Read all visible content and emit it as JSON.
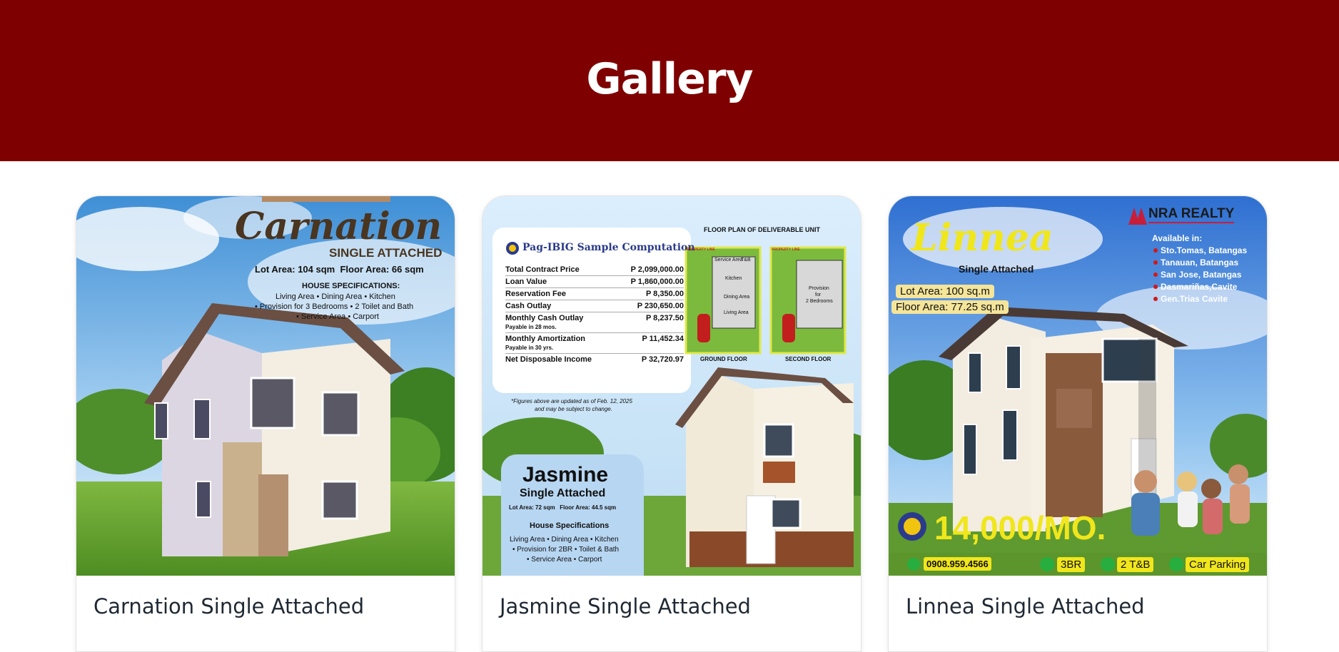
{
  "page": {
    "title": "Gallery"
  },
  "colors": {
    "header_bg": "#7f0000",
    "title_text": "#ffffff",
    "card_title": "#1f2933"
  },
  "cards": [
    {
      "title": "Carnation Single Attached",
      "image": {
        "brand": "Carnation",
        "subtitle": "SINGLE ATTACHED",
        "areas": "Lot Area: 104 sqm  Floor Area: 66 sqm",
        "spec_heading": "HOUSE SPECIFICATIONS:",
        "spec_lines": [
          "Living Area • Dining Area • Kitchen",
          "• Provision for 3 Bedrooms • 2 Toilet and Bath",
          "• Service Area • Carport"
        ]
      }
    },
    {
      "title": "Jasmine Single Attached",
      "image": {
        "computation_title": "Pag-IBIG Sample Computation",
        "rows": [
          {
            "label": "Total Contract Price",
            "value": "P 2,099,000.00",
            "note": ""
          },
          {
            "label": "Loan Value",
            "value": "P 1,860,000.00",
            "note": ""
          },
          {
            "label": "Reservation Fee",
            "value": "P 8,350.00",
            "note": ""
          },
          {
            "label": "Cash Outlay",
            "value": "P 230,650.00",
            "note": ""
          },
          {
            "label": "Monthly Cash Outlay",
            "value": "P 8,237.50",
            "note": "Payable in 28 mos."
          },
          {
            "label": "Monthly Amortization",
            "value": "P 11,452.34",
            "note": "Payable in 30 yrs."
          },
          {
            "label": "Net Disposable Income",
            "value": "P 32,720.97",
            "note": ""
          }
        ],
        "footnote_1": "*Figures above are updated as of Feb. 12, 2025",
        "footnote_2": "and may be subject to change.",
        "floorplan_title": "FLOOR PLAN OF DELIVERABLE UNIT",
        "property_line": "PROPERTY LINE",
        "ground_rooms": [
          "Service Area",
          "T&B",
          "Kitchen",
          "Dining Area",
          "Living Area"
        ],
        "second_rooms": [
          "Provision",
          "for",
          "2 Bedrooms"
        ],
        "ground_floor": "GROUND FLOOR",
        "second_floor": "SECOND FLOOR",
        "brand": "Jasmine",
        "subtitle": "Single Attached",
        "areas": "Lot Area: 72 sqm   Floor Area: 44.5 sqm",
        "spec_heading": "House Specifications",
        "spec_lines": [
          "Living Area • Dining Area • Kitchen",
          "• Provision for 2BR • Toilet & Bath",
          "• Service Area • Carport"
        ]
      }
    },
    {
      "title": "Linnea Single Attached",
      "image": {
        "realty": "NRA REALTY",
        "brand": "Linnea",
        "subtitle": "Single Attached",
        "lot_area": "Lot Area: 100 sq.m",
        "floor_area": "Floor Area: 77.25 sq.m",
        "available_heading": "Available in:",
        "locations": [
          "Sto.Tomas, Batangas",
          "Tanauan, Batangas",
          "San Jose, Batangas",
          "Dasmariñas,Cavite",
          "Gen.Trias Cavite"
        ],
        "price": "14,000/MO.",
        "phone": "0908.959.4566",
        "features": [
          "3BR",
          "2 T&B",
          "Car Parking"
        ]
      }
    }
  ]
}
